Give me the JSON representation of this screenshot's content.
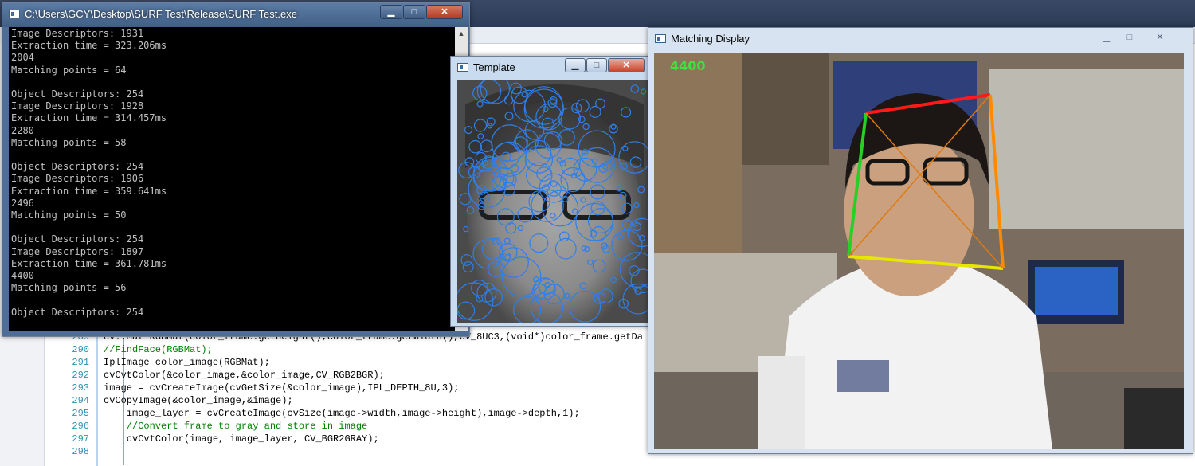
{
  "editor": {
    "lines": [
      {
        "num": "289",
        "text": "cv::Mat RGBMat(color_frame.getHeight(),color_frame.getWidth(),CV_8UC3,(void*)color_frame.getDa",
        "comment": false
      },
      {
        "num": "290",
        "text": "//FindFace(RGBMat);",
        "comment": true
      },
      {
        "num": "291",
        "text": "IplImage color_image(RGBMat);",
        "comment": false
      },
      {
        "num": "292",
        "text": "cvCvtColor(&color_image,&color_image,CV_RGB2BGR);",
        "comment": false
      },
      {
        "num": "293",
        "text": "image = cvCreateImage(cvGetSize(&color_image),IPL_DEPTH_8U,3);",
        "comment": false
      },
      {
        "num": "294",
        "text": "cvCopyImage(&color_image,&image);",
        "comment": false
      },
      {
        "num": "295",
        "text": "    image_layer = cvCreateImage(cvSize(image->width,image->height),image->depth,1);",
        "comment": false
      },
      {
        "num": "296",
        "text": "    //Convert frame to gray and store in image",
        "comment": true
      },
      {
        "num": "297",
        "text": "    cvCvtColor(image, image_layer, CV_BGR2GRAY);",
        "comment": false
      },
      {
        "num": "298",
        "text": "",
        "comment": false
      }
    ]
  },
  "console_window": {
    "title": "C:\\Users\\GCY\\Desktop\\SURF Test\\Release\\SURF Test.exe",
    "minimize": "▁",
    "maximize": "□",
    "close": "✕",
    "lines": [
      "Image Descriptors: 1931",
      "Extraction time = 323.206ms",
      "2004",
      "Matching points = 64",
      "",
      "Object Descriptors: 254",
      "Image Descriptors: 1928",
      "Extraction time = 314.457ms",
      "2280",
      "Matching points = 58",
      "",
      "Object Descriptors: 254",
      "Image Descriptors: 1906",
      "Extraction time = 359.641ms",
      "2496",
      "Matching points = 50",
      "",
      "Object Descriptors: 254",
      "Image Descriptors: 1897",
      "Extraction time = 361.781ms",
      "4400",
      "Matching points = 56",
      "",
      "Object Descriptors: 254"
    ],
    "scroll_up": "▲"
  },
  "template_window": {
    "title": "Template",
    "minimize": "▁",
    "maximize": "□",
    "close": "✕"
  },
  "matching_window": {
    "title": "Matching Display",
    "minimize": "▁",
    "maximize": "□",
    "close": "✕",
    "overlay_value": "4400"
  },
  "colors": {
    "keypoint_circle": "#2f7fe8",
    "box_top": "#ff1a1a",
    "box_left": "#26d026",
    "box_bottom": "#e6e600",
    "box_right": "#ff8a00",
    "diagonals": "#e07a10",
    "overlay_text": "#3fe03f"
  }
}
